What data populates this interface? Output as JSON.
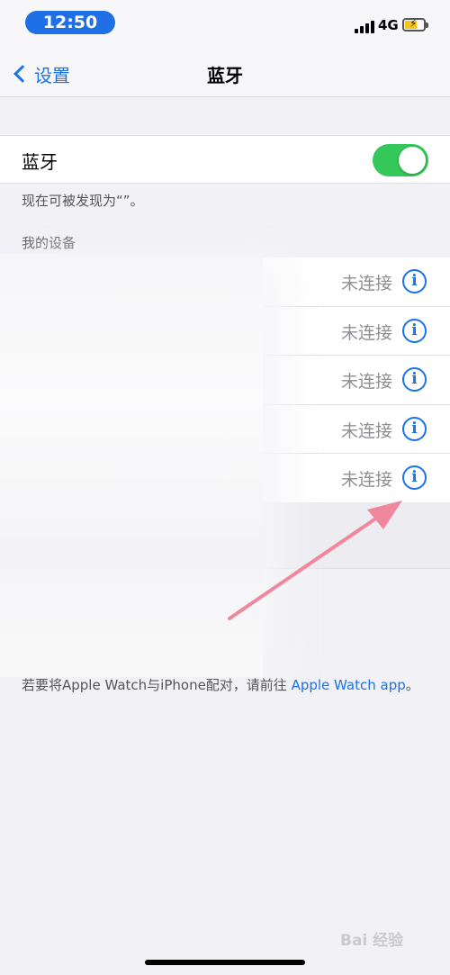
{
  "status": {
    "time": "12:50",
    "network": "4G"
  },
  "nav": {
    "back_label": "设置",
    "title": "蓝牙"
  },
  "bluetooth": {
    "label": "蓝牙",
    "enabled": true
  },
  "discoverable_text": "现在可被发现为“”。",
  "section_header": "我的设备",
  "devices": [
    {
      "state": "未连接"
    },
    {
      "state": "未连接"
    },
    {
      "state": "未连接"
    },
    {
      "state": "未连接"
    },
    {
      "state": "未连接"
    }
  ],
  "footer": {
    "prefix": "若要将Apple Watch与iPhone配对，请前往 ",
    "link": "Apple Watch app",
    "suffix": "。"
  },
  "watermark": "Bai 经验",
  "colors": {
    "accent": "#1a73e8",
    "toggle_on": "#34c759",
    "time_pill": "#1f6fe6",
    "annotation_arrow": "#f0879e"
  }
}
